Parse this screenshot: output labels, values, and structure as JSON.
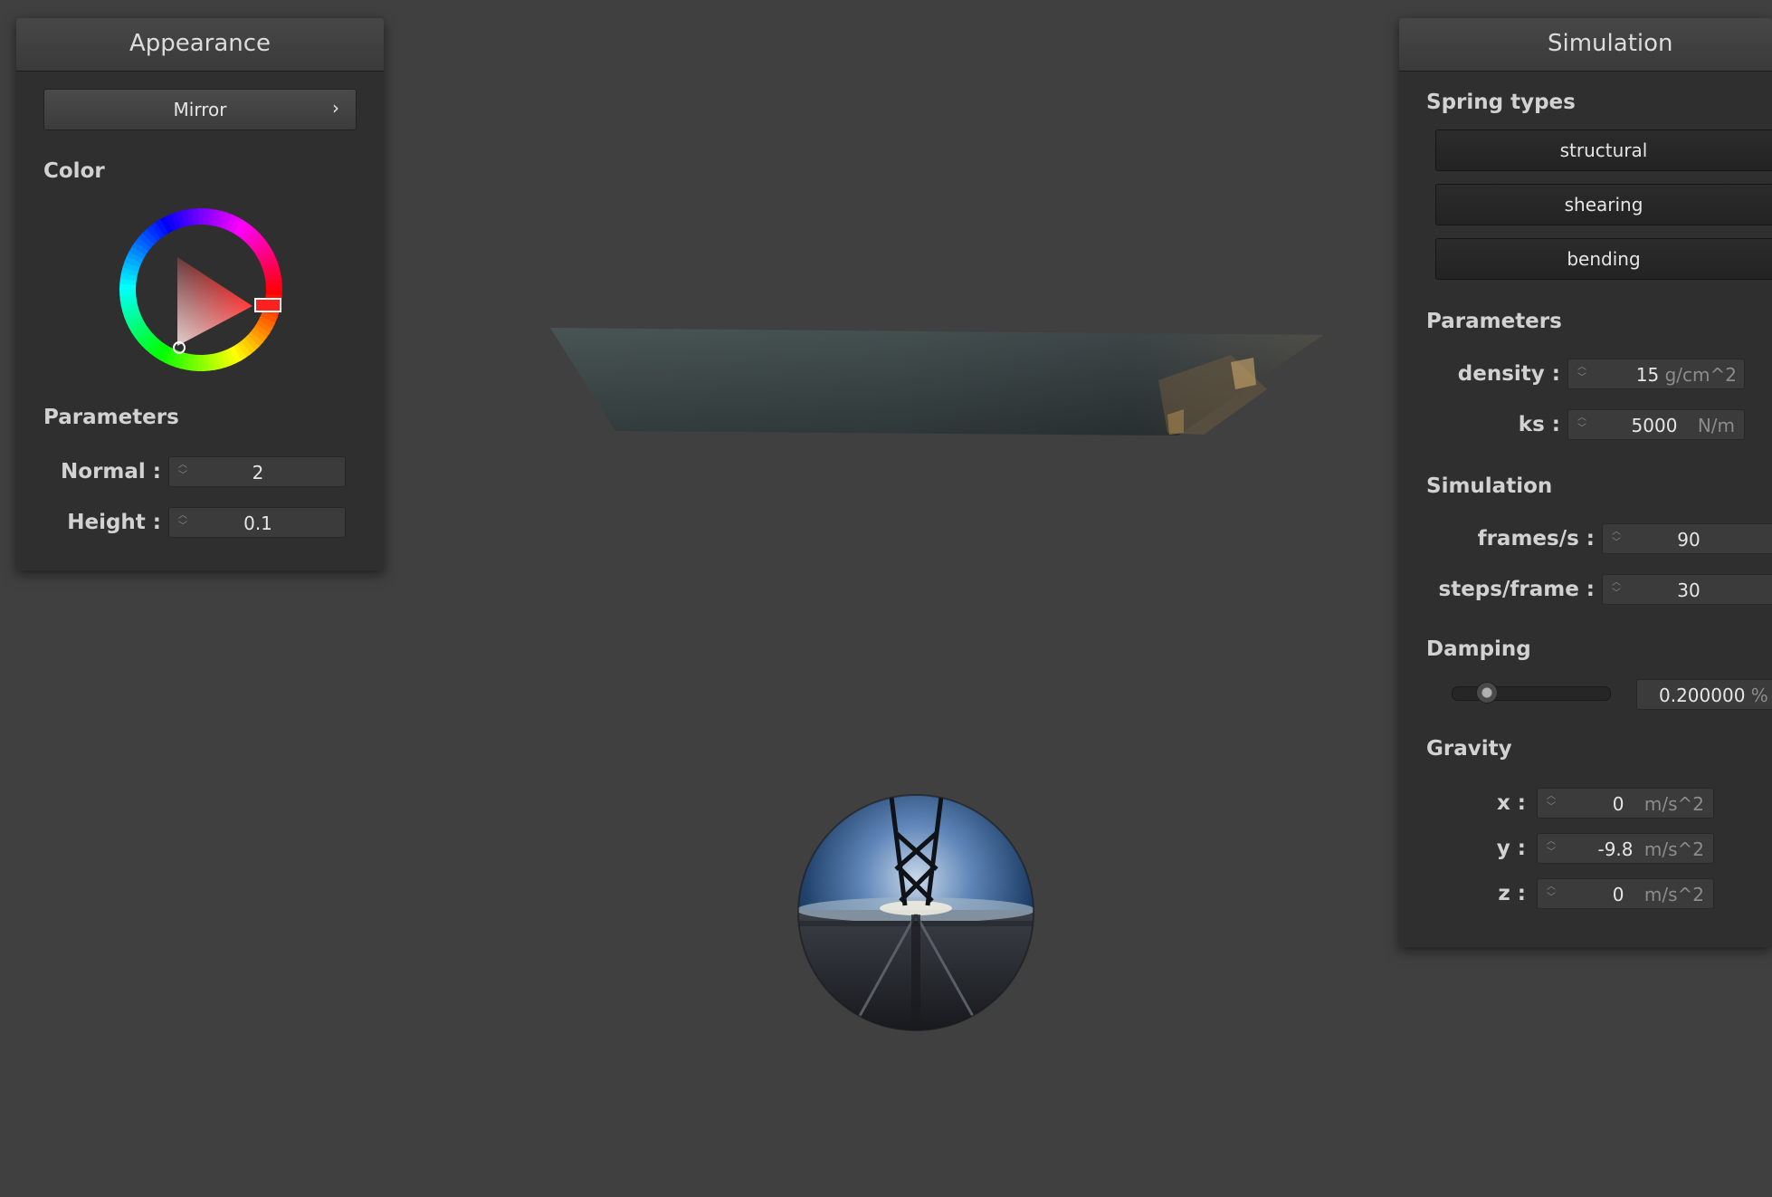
{
  "appearance": {
    "title": "Appearance",
    "shader_label": "Mirror",
    "shader_chevron": "›",
    "color_title": "Color",
    "params_title": "Parameters",
    "normal_label": "Normal :",
    "normal_value": "2",
    "height_label": "Height :",
    "height_value": "0.1",
    "selected_color": "#ff0000"
  },
  "simulation": {
    "title": "Simulation",
    "spring_title": "Spring types",
    "springs": [
      "structural",
      "shearing",
      "bending"
    ],
    "params_title": "Parameters",
    "density_label": "density :",
    "density_value": "15",
    "density_unit": "g/cm^2",
    "ks_label": "ks :",
    "ks_value": "5000",
    "ks_unit": "N/m",
    "sim_title": "Simulation",
    "fps_label": "frames/s :",
    "fps_value": "90",
    "steps_label": "steps/frame :",
    "steps_value": "30",
    "damping_title": "Damping",
    "damping_value": "0.200000",
    "damping_unit": "%",
    "damping_level": 0.2,
    "gravity_title": "Gravity",
    "gx_label": "x :",
    "gx_value": "0",
    "gy_label": "y :",
    "gy_value": "-9.8",
    "gz_label": "z :",
    "gz_value": "0",
    "g_unit": "m/s^2"
  },
  "colors": {
    "background": "#404040",
    "panel": "#2f2f2f"
  }
}
